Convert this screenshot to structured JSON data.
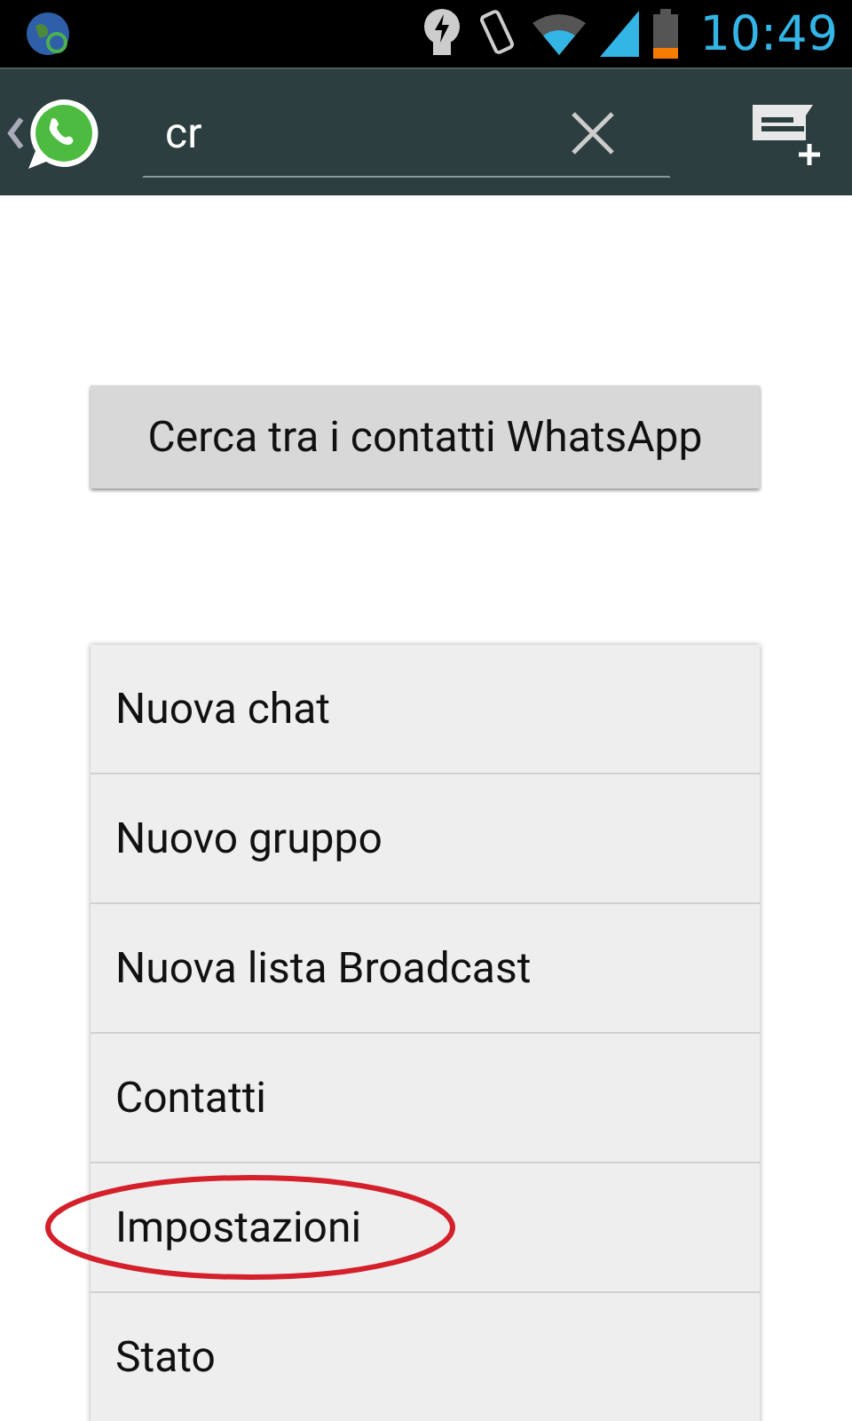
{
  "status_bar": {
    "time": "10:49"
  },
  "action_bar": {
    "search": {
      "value": "cr"
    }
  },
  "search_button": {
    "label": "Cerca tra i contatti WhatsApp"
  },
  "menu": {
    "items": [
      {
        "label": "Nuova chat",
        "circled": false
      },
      {
        "label": "Nuovo gruppo",
        "circled": false
      },
      {
        "label": "Nuova lista Broadcast",
        "circled": false
      },
      {
        "label": "Contatti",
        "circled": false
      },
      {
        "label": "Impostazioni",
        "circled": true
      },
      {
        "label": "Stato",
        "circled": false
      }
    ]
  }
}
